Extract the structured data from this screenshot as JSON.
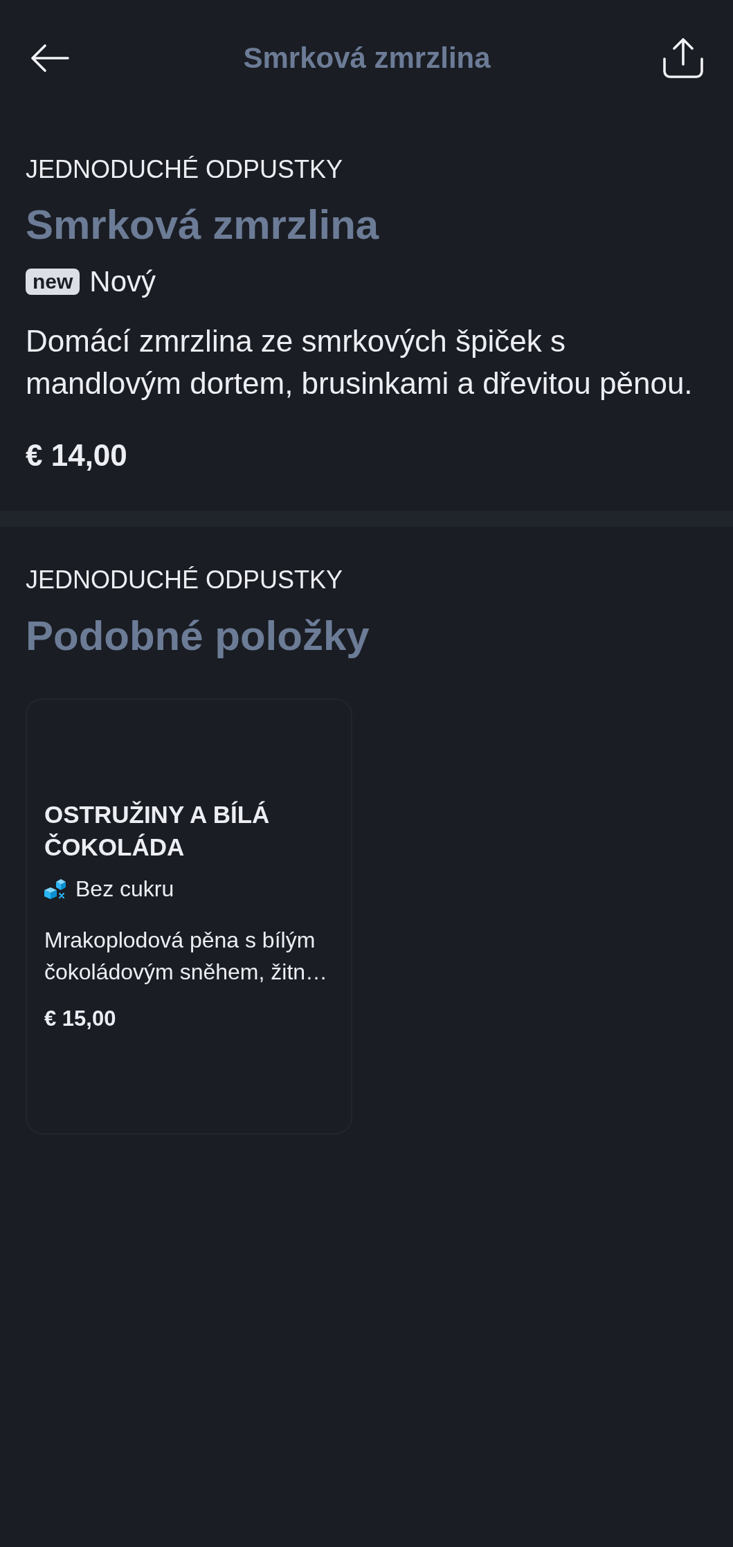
{
  "header": {
    "title": "Smrková zmrzlina"
  },
  "item": {
    "category": "JEDNODUCHÉ ODPUSTKY",
    "name": "Smrková zmrzlina",
    "tags": [
      {
        "kind": "badge",
        "badge": "new",
        "label": "Nový"
      }
    ],
    "description": "Domácí zmrzlina ze smrkových špiček s mandlovým dortem, brusinkami a dřevitou pěnou.",
    "price": "€ 14,00"
  },
  "similar": {
    "category": "JEDNODUCHÉ ODPUSTKY",
    "title": "Podobné položky",
    "items": [
      {
        "name": "OSTRUŽINY A BÍLÁ ČOKOLÁDA",
        "tags": [
          {
            "kind": "sugar_free",
            "label": "Bez cukru"
          }
        ],
        "description": "Mrakoplodová pěna s bílým čokoládovým sněhem, žitn…",
        "price": "€ 15,00"
      }
    ]
  }
}
